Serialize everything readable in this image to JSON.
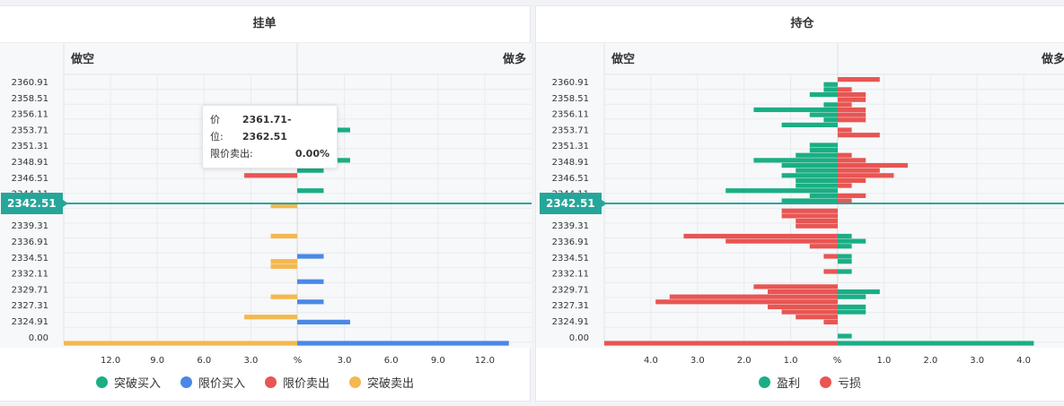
{
  "colors": {
    "break_buy": "#1aae84",
    "limit_buy": "#4a88e6",
    "limit_sell": "#e85552",
    "break_sell": "#f3b84f",
    "profit": "#1aae84",
    "loss": "#e85552",
    "price_line": "#26a69a"
  },
  "current_price": "2342.51",
  "tooltip": {
    "price_label": "价位:",
    "price_value": "2361.71-2362.51",
    "type_label": "限价卖出:",
    "type_value": "0.00%"
  },
  "chart_data": [
    {
      "type": "bar",
      "orientation": "horizontal",
      "title": "挂单",
      "left_header": "做空",
      "right_header": "做多",
      "y_tick_labels": [
        "2360.91",
        "2358.51",
        "2356.11",
        "2353.71",
        "2351.31",
        "2348.91",
        "2346.51",
        "2344.11",
        "2341.71",
        "2339.31",
        "2336.91",
        "2334.51",
        "2332.11",
        "2329.71",
        "2327.31",
        "2324.91",
        "0.00"
      ],
      "x_tick_labels": [
        "12.0",
        "9.0",
        "6.0",
        "3.0",
        "%",
        "3.0",
        "6.0",
        "9.0",
        "12.0"
      ],
      "xlim": [
        -15,
        15
      ],
      "legend": [
        "突破买入",
        "限价买入",
        "限价卖出",
        "突破卖出"
      ],
      "legend_colors": [
        "#1aae84",
        "#4a88e6",
        "#e85552",
        "#f3b84f"
      ],
      "series": [
        {
          "name": "突破买入",
          "side": "right",
          "values": [
            {
              "y": 2353.71,
              "v": 3.4
            },
            {
              "y": 2348.91,
              "v": 3.4
            },
            {
              "y": 2347.31,
              "v": 1.7
            },
            {
              "y": 2344.11,
              "v": 1.7
            }
          ]
        },
        {
          "name": "限价买入",
          "side": "right",
          "values": [
            {
              "y": 2333.71,
              "v": 1.7
            },
            {
              "y": 2329.71,
              "v": 1.7
            },
            {
              "y": 2326.51,
              "v": 1.7
            },
            {
              "y": 2323.31,
              "v": 3.4
            },
            {
              "y": 0,
              "v": 13.6
            }
          ]
        },
        {
          "name": "限价卖出",
          "side": "left",
          "values": [
            {
              "y": 2346.51,
              "v": 3.4
            }
          ]
        },
        {
          "name": "突破卖出",
          "side": "left",
          "values": [
            {
              "y": 2341.71,
              "v": 1.7
            },
            {
              "y": 2336.91,
              "v": 1.7
            },
            {
              "y": 2332.91,
              "v": 1.7
            },
            {
              "y": 2332.11,
              "v": 1.7
            },
            {
              "y": 2327.31,
              "v": 1.7
            },
            {
              "y": 2324.11,
              "v": 3.4
            },
            {
              "y": 0,
              "v": 15
            }
          ]
        }
      ]
    },
    {
      "type": "bar",
      "orientation": "horizontal",
      "title": "持仓",
      "left_header": "做空",
      "right_header": "做多",
      "y_tick_labels": [
        "2360.91",
        "2358.51",
        "2356.11",
        "2353.71",
        "2351.31",
        "2348.91",
        "2346.51",
        "2344.11",
        "2341.71",
        "2339.31",
        "2336.91",
        "2334.51",
        "2332.11",
        "2329.71",
        "2327.31",
        "2324.91",
        "0.00"
      ],
      "x_tick_labels": [
        "4.0",
        "3.0",
        "2.0",
        "1.0",
        "%",
        "1.0",
        "2.0",
        "3.0",
        "4.0"
      ],
      "xlim": [
        -5,
        5
      ],
      "legend": [
        "盈利",
        "亏损"
      ],
      "legend_colors": [
        "#1aae84",
        "#e85552"
      ],
      "short_rows": [
        {
          "y": 2361.71,
          "profit": 0,
          "loss": 0
        },
        {
          "y": 2360.91,
          "profit": 0.3,
          "loss": 0
        },
        {
          "y": 2360.11,
          "profit": 0.3,
          "loss": 0
        },
        {
          "y": 2359.31,
          "profit": 0.6,
          "loss": 0
        },
        {
          "y": 2357.71,
          "profit": 0.3,
          "loss": 0
        },
        {
          "y": 2356.91,
          "profit": 1.8,
          "loss": 0
        },
        {
          "y": 2356.11,
          "profit": 0.6,
          "loss": 0
        },
        {
          "y": 2355.31,
          "profit": 0.3,
          "loss": 0
        },
        {
          "y": 2354.51,
          "profit": 1.2,
          "loss": 0
        },
        {
          "y": 2351.31,
          "profit": 0.6,
          "loss": 0
        },
        {
          "y": 2350.51,
          "profit": 0.6,
          "loss": 0
        },
        {
          "y": 2349.71,
          "profit": 0.9,
          "loss": 0
        },
        {
          "y": 2348.91,
          "profit": 1.8,
          "loss": 0
        },
        {
          "y": 2348.11,
          "profit": 1.2,
          "loss": 0
        },
        {
          "y": 2347.31,
          "profit": 0.9,
          "loss": 0
        },
        {
          "y": 2346.51,
          "profit": 1.2,
          "loss": 0
        },
        {
          "y": 2345.71,
          "profit": 0.9,
          "loss": 0
        },
        {
          "y": 2344.91,
          "profit": 0.9,
          "loss": 0
        },
        {
          "y": 2344.11,
          "profit": 2.4,
          "loss": 0
        },
        {
          "y": 2343.31,
          "profit": 0.6,
          "loss": 0
        },
        {
          "y": 2342.51,
          "profit": 1.2,
          "loss": 0
        },
        {
          "y": 2340.91,
          "profit": 0,
          "loss": 1.2
        },
        {
          "y": 2340.11,
          "profit": 0,
          "loss": 1.2
        },
        {
          "y": 2339.31,
          "profit": 0,
          "loss": 0.9
        },
        {
          "y": 2338.51,
          "profit": 0,
          "loss": 0.9
        },
        {
          "y": 2336.91,
          "profit": 0,
          "loss": 3.3
        },
        {
          "y": 2336.11,
          "profit": 0,
          "loss": 2.4
        },
        {
          "y": 2335.31,
          "profit": 0,
          "loss": 0.6
        },
        {
          "y": 2333.71,
          "profit": 0,
          "loss": 0.3
        },
        {
          "y": 2331.31,
          "profit": 0,
          "loss": 0.3
        },
        {
          "y": 2328.91,
          "profit": 0,
          "loss": 1.8
        },
        {
          "y": 2328.11,
          "profit": 0,
          "loss": 1.5
        },
        {
          "y": 2327.31,
          "profit": 0,
          "loss": 3.6
        },
        {
          "y": 2326.51,
          "profit": 0,
          "loss": 3.9
        },
        {
          "y": 2325.71,
          "profit": 0,
          "loss": 1.5
        },
        {
          "y": 2324.91,
          "profit": 0,
          "loss": 1.2
        },
        {
          "y": 2324.11,
          "profit": 0,
          "loss": 0.9
        },
        {
          "y": 2323.31,
          "profit": 0,
          "loss": 0.3
        },
        {
          "y": 0,
          "profit": 0,
          "loss": 5.0
        }
      ],
      "long_rows": [
        {
          "y": 2361.71,
          "profit": 0,
          "loss": 0.9
        },
        {
          "y": 2360.11,
          "profit": 0,
          "loss": 0.3
        },
        {
          "y": 2359.31,
          "profit": 0,
          "loss": 0.6
        },
        {
          "y": 2358.51,
          "profit": 0,
          "loss": 0.6
        },
        {
          "y": 2357.71,
          "profit": 0,
          "loss": 0.3
        },
        {
          "y": 2356.91,
          "profit": 0,
          "loss": 0.6
        },
        {
          "y": 2356.11,
          "profit": 0,
          "loss": 0.6
        },
        {
          "y": 2355.31,
          "profit": 0,
          "loss": 0.6
        },
        {
          "y": 2353.71,
          "profit": 0,
          "loss": 0.3
        },
        {
          "y": 2352.91,
          "profit": 0,
          "loss": 0.9
        },
        {
          "y": 2349.71,
          "profit": 0,
          "loss": 0.3
        },
        {
          "y": 2348.91,
          "profit": 0,
          "loss": 0.6
        },
        {
          "y": 2348.11,
          "profit": 0,
          "loss": 1.5
        },
        {
          "y": 2347.31,
          "profit": 0,
          "loss": 0.9
        },
        {
          "y": 2346.51,
          "profit": 0,
          "loss": 1.2
        },
        {
          "y": 2345.71,
          "profit": 0,
          "loss": 0.6
        },
        {
          "y": 2344.91,
          "profit": 0,
          "loss": 0.3
        },
        {
          "y": 2343.31,
          "profit": 0,
          "loss": 0.6
        },
        {
          "y": 2342.51,
          "profit": 0,
          "loss": 0.3
        },
        {
          "y": 2336.91,
          "profit": 0.3,
          "loss": 0
        },
        {
          "y": 2336.11,
          "profit": 0.6,
          "loss": 0
        },
        {
          "y": 2335.31,
          "profit": 0.3,
          "loss": 0
        },
        {
          "y": 2333.71,
          "profit": 0.3,
          "loss": 0
        },
        {
          "y": 2332.91,
          "profit": 0.3,
          "loss": 0
        },
        {
          "y": 2331.31,
          "profit": 0.3,
          "loss": 0
        },
        {
          "y": 2328.11,
          "profit": 0.9,
          "loss": 0
        },
        {
          "y": 2327.31,
          "profit": 0.6,
          "loss": 0
        },
        {
          "y": 2325.71,
          "profit": 0.6,
          "loss": 0
        },
        {
          "y": 2324.91,
          "profit": 0.6,
          "loss": 0
        },
        {
          "y": 0,
          "profit": 0.3,
          "loss": 0
        },
        {
          "y": -1,
          "profit": 4.2,
          "loss": 0
        }
      ]
    }
  ]
}
